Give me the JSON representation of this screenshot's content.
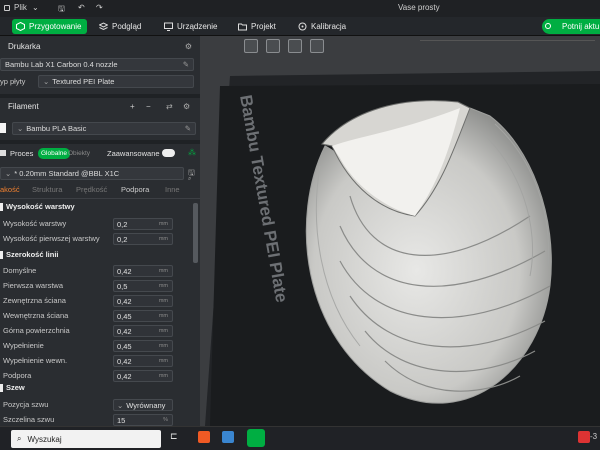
{
  "titlebar": {
    "file_menu": "Plik",
    "window_title": "Vase prosty"
  },
  "tabs": [
    {
      "label": "Przygotowanie",
      "icon": "cube-icon"
    },
    {
      "label": "Podgląd",
      "icon": "layers-icon"
    },
    {
      "label": "Urządzenie",
      "icon": "monitor-icon"
    },
    {
      "label": "Projekt",
      "icon": "folder-icon"
    },
    {
      "label": "Kalibracja",
      "icon": "target-icon"
    }
  ],
  "action_button": "Potnij aktu",
  "printer": {
    "title": "Drukarka",
    "name": "Bambu Lab X1 Carbon 0.4 nozzle",
    "plate_label": "yp płyty",
    "plate_value": "Textured PEI Plate"
  },
  "filament": {
    "title": "Filament",
    "value": "Bambu PLA Basic"
  },
  "process": {
    "title": "Proces",
    "toggle_global": "Globalne",
    "toggle_objects": "Obiekty",
    "advanced": "Zaawansowane",
    "profile": "* 0.20mm Standard @BBL X1C"
  },
  "subtabs": [
    "akość",
    "Struktura",
    "Prędkość",
    "Podpora",
    "Inne"
  ],
  "groups": [
    {
      "title": "Wysokość warstwy",
      "rows": [
        {
          "label": "Wysokość warstwy",
          "value": "0,2",
          "unit": "mm"
        },
        {
          "label": "Wysokość pierwszej warstwy",
          "value": "0,2",
          "unit": "mm"
        }
      ]
    },
    {
      "title": "Szerokość linii",
      "rows": [
        {
          "label": "Domyślne",
          "value": "0,42",
          "unit": "mm"
        },
        {
          "label": "Pierwsza warstwa",
          "value": "0,5",
          "unit": "mm"
        },
        {
          "label": "Zewnętrzna ściana",
          "value": "0,42",
          "unit": "mm"
        },
        {
          "label": "Wewnętrzna ściana",
          "value": "0,45",
          "unit": "mm"
        },
        {
          "label": "Górna powierzchnia",
          "value": "0,42",
          "unit": "mm"
        },
        {
          "label": "Wypełnienie",
          "value": "0,45",
          "unit": "mm"
        },
        {
          "label": "Wypełnienie wewn.",
          "value": "0,42",
          "unit": "mm"
        },
        {
          "label": "Podpora",
          "value": "0,42",
          "unit": "mm"
        }
      ]
    },
    {
      "title": "Szew",
      "rows": [
        {
          "label": "Pozycja szwu",
          "value": "Wyrównany",
          "unit": ""
        },
        {
          "label": "Szczelina szwu",
          "value": "15",
          "unit": "%"
        }
      ]
    }
  ],
  "plate_text": "Bambu Textured PEI Plate",
  "taskbar": {
    "search_placeholder": "Wyszukaj",
    "clock": "-3"
  },
  "colors": {
    "accent": "#00ae42",
    "panel": "#2a2d31",
    "viewport": "#3b3d40"
  }
}
